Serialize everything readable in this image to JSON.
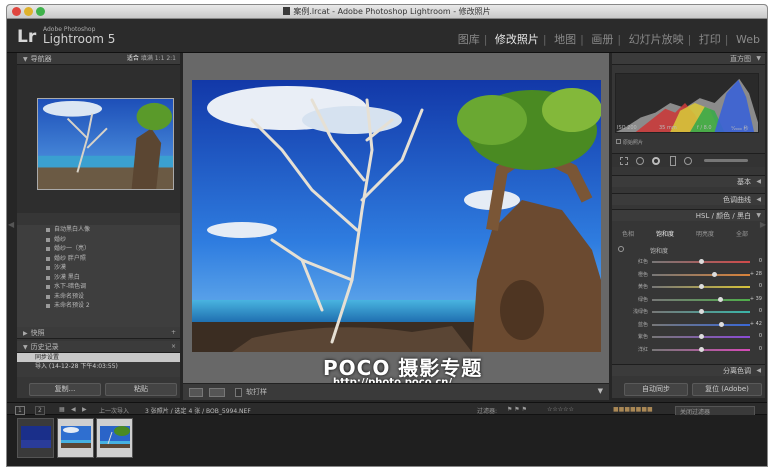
{
  "window": {
    "title": "案例.lrcat - Adobe Photoshop Lightroom - 修改照片"
  },
  "identity": {
    "logo": "Lr",
    "vendor": "Adobe Photoshop",
    "product": "Lightroom 5"
  },
  "modules": [
    {
      "label": "图库",
      "active": false
    },
    {
      "label": "修改照片",
      "active": true
    },
    {
      "label": "地图",
      "active": false
    },
    {
      "label": "画册",
      "active": false
    },
    {
      "label": "幻灯片放映",
      "active": false
    },
    {
      "label": "打印",
      "active": false
    },
    {
      "label": "Web",
      "active": false
    }
  ],
  "left": {
    "navigator": {
      "title": "导航器",
      "zoom_options": [
        "适合",
        "填满",
        "1:1",
        "2:1"
      ]
    },
    "presets": [
      "自动黑白人像",
      "婚纱",
      "婚纱一（亮）",
      "婚纱 胖户照",
      "沙漠",
      "沙漠 黑白",
      "水下-暗色调",
      "未命名预设",
      "未命名预设 2"
    ],
    "snapshots": {
      "title": "快照",
      "action": "+"
    },
    "history": {
      "title": "历史记录",
      "action": "×",
      "items": [
        {
          "label": "同步设置",
          "selected": true
        },
        {
          "label": "导入 (14-12-28 下午4:03:55)",
          "selected": false
        }
      ]
    },
    "copy_label": "复制...",
    "paste_label": "粘贴"
  },
  "toolbar": {
    "softproof_label": "软打样"
  },
  "watermark": {
    "brand": "POCO 摄影专题",
    "url": "http://photo.poco.cn/"
  },
  "right": {
    "histogram": {
      "title": "直方图",
      "iso": "ISO 200",
      "focal": "35 mm",
      "aperture": "f / 8.0",
      "shutter": "¹⁄₂₀₀₀ 秒",
      "original": "原始照片"
    },
    "basic": "基本",
    "tone_curve": "色调曲线",
    "hsl_header": "HSL / 颜色 / 黑白",
    "hsl_tabs": [
      "色相",
      "饱和度",
      "明亮度",
      "全部"
    ],
    "saturation_label": "饱和度",
    "sliders": [
      {
        "label": "红色",
        "value": "0",
        "pos": 0.5,
        "color": "#d14a4a"
      },
      {
        "label": "橙色",
        "value": "+ 28",
        "pos": 0.64,
        "color": "#d9823a"
      },
      {
        "label": "黄色",
        "value": "0",
        "pos": 0.5,
        "color": "#d6c23a"
      },
      {
        "label": "绿色",
        "value": "+ 39",
        "pos": 0.7,
        "color": "#4fae4a"
      },
      {
        "label": "浅绿色",
        "value": "0",
        "pos": 0.5,
        "color": "#3ab5a8"
      },
      {
        "label": "蓝色",
        "value": "+ 42",
        "pos": 0.71,
        "color": "#3a68d6"
      },
      {
        "label": "紫色",
        "value": "0",
        "pos": 0.5,
        "color": "#8a4ad6"
      },
      {
        "label": "洋红",
        "value": "0",
        "pos": 0.5,
        "color": "#d64ab8"
      }
    ],
    "split_toning": "分离色调",
    "sync_label": "自动同步",
    "reset_label": "复位 (Adobe)"
  },
  "filmstrip": {
    "view1": "1",
    "view2": "2",
    "source": "上一次导入",
    "selection": "3 张照片 / 选定 4 张 / BOB_5994.NEF",
    "filter_label": "过滤器:",
    "filter_value": "关闭过滤器"
  }
}
